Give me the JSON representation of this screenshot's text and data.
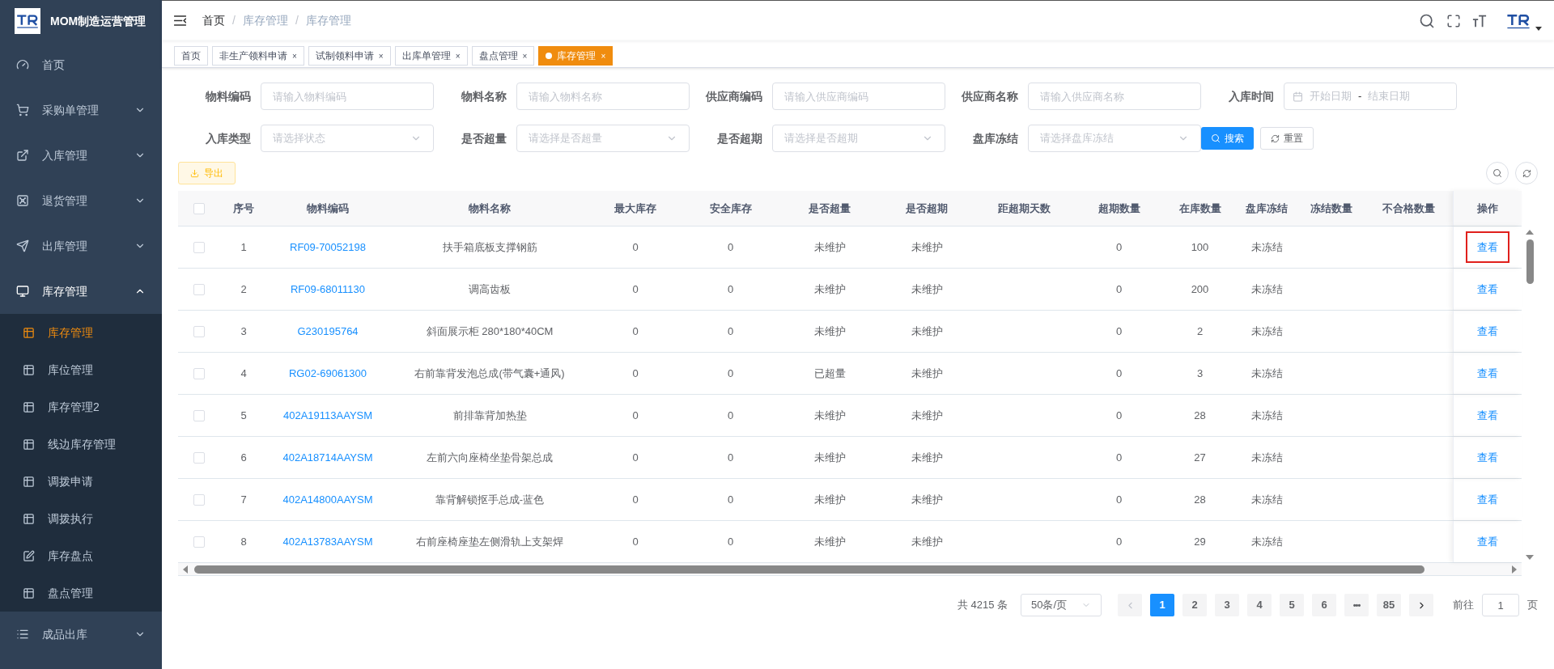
{
  "sidebar": {
    "title": "MOM制造运营管理",
    "items": [
      {
        "label": "首页",
        "kind": "link"
      },
      {
        "label": "采购单管理",
        "kind": "submenu",
        "expanded": false
      },
      {
        "label": "入库管理",
        "kind": "submenu",
        "expanded": false
      },
      {
        "label": "退货管理",
        "kind": "submenu",
        "expanded": false
      },
      {
        "label": "出库管理",
        "kind": "submenu",
        "expanded": false
      },
      {
        "label": "库存管理",
        "kind": "submenu",
        "expanded": true,
        "children": [
          {
            "label": "库存管理",
            "selected": true
          },
          {
            "label": "库位管理",
            "selected": false
          },
          {
            "label": "库存管理2",
            "selected": false
          },
          {
            "label": "线边库存管理",
            "selected": false
          },
          {
            "label": "调拨申请",
            "selected": false
          },
          {
            "label": "调拨执行",
            "selected": false
          },
          {
            "label": "库存盘点",
            "selected": false
          },
          {
            "label": "盘点管理",
            "selected": false
          }
        ]
      },
      {
        "label": "成品出库",
        "kind": "submenu",
        "expanded": false
      }
    ]
  },
  "breadcrumb": {
    "separator": "/",
    "items": [
      "首页",
      "库存管理",
      "库存管理"
    ]
  },
  "tabs": [
    {
      "label": "首页",
      "selected": false
    },
    {
      "label": "非生产领料申请",
      "selected": false,
      "close": "×"
    },
    {
      "label": "试制领料申请",
      "selected": false,
      "close": "×"
    },
    {
      "label": "出库单管理",
      "selected": false,
      "close": "×"
    },
    {
      "label": "盘点管理",
      "selected": false,
      "close": "×"
    },
    {
      "label": "库存管理",
      "selected": true,
      "close": "×"
    }
  ],
  "filters": [
    {
      "label": "物料编码",
      "kind": "input",
      "placeholder": "请输入物料编码"
    },
    {
      "label": "物料名称",
      "kind": "input",
      "placeholder": "请输入物料名称"
    },
    {
      "label": "供应商编码",
      "kind": "input",
      "placeholder": "请输入供应商编码"
    },
    {
      "label": "供应商名称",
      "kind": "input",
      "placeholder": "请输入供应商名称"
    },
    {
      "label": "入库时间",
      "kind": "daterange",
      "placeholder": "开始日期",
      "placeholder_end": "结束日期",
      "separator": "-"
    },
    {
      "label": "入库类型",
      "kind": "select",
      "placeholder": "请选择状态"
    },
    {
      "label": "是否超量",
      "kind": "select",
      "placeholder": "请选择是否超量"
    },
    {
      "label": "是否超期",
      "kind": "select",
      "placeholder": "请选择是否超期"
    },
    {
      "label": "盘库冻结",
      "kind": "select",
      "placeholder": "请选择盘库冻结"
    }
  ],
  "search_button": "搜索",
  "reset_button": "重置",
  "export_button": "导出",
  "table": {
    "all_checked": false,
    "columns": [
      "序号",
      "物料编码",
      "物料名称",
      "最大库存",
      "安全库存",
      "是否超量",
      "是否超期",
      "距超期天数",
      "超期数量",
      "在库数量",
      "盘库冻结",
      "冻结数量",
      "不合格数量",
      "操作"
    ],
    "rows": [
      {
        "checked": false,
        "highlighted": true,
        "cells": [
          "1",
          "RF09-70052198",
          "扶手箱底板支撑钢筋",
          "0",
          "0",
          "未维护",
          "未维护",
          "",
          "0",
          "100",
          "未冻结",
          "",
          "",
          "查看"
        ]
      },
      {
        "checked": false,
        "highlighted": false,
        "cells": [
          "2",
          "RF09-68011130",
          "调高齿板",
          "0",
          "0",
          "未维护",
          "未维护",
          "",
          "0",
          "200",
          "未冻结",
          "",
          "",
          "查看"
        ]
      },
      {
        "checked": false,
        "highlighted": false,
        "cells": [
          "3",
          "G230195764",
          "斜面展示柜 280*180*40CM",
          "0",
          "0",
          "未维护",
          "未维护",
          "",
          "0",
          "2",
          "未冻结",
          "",
          "",
          "查看"
        ]
      },
      {
        "checked": false,
        "highlighted": false,
        "cells": [
          "4",
          "RG02-69061300",
          "右前靠背发泡总成(带气囊+通风)",
          "0",
          "0",
          "已超量",
          "未维护",
          "",
          "0",
          "3",
          "未冻结",
          "",
          "",
          "查看"
        ]
      },
      {
        "checked": false,
        "highlighted": false,
        "cells": [
          "5",
          "402A19113AAYSM",
          "前排靠背加热垫",
          "0",
          "0",
          "未维护",
          "未维护",
          "",
          "0",
          "28",
          "未冻结",
          "",
          "",
          "查看"
        ]
      },
      {
        "checked": false,
        "highlighted": false,
        "cells": [
          "6",
          "402A18714AAYSM",
          "左前六向座椅坐垫骨架总成",
          "0",
          "0",
          "未维护",
          "未维护",
          "",
          "0",
          "27",
          "未冻结",
          "",
          "",
          "查看"
        ]
      },
      {
        "checked": false,
        "highlighted": false,
        "cells": [
          "7",
          "402A14800AAYSM",
          "靠背解锁抠手总成-蓝色",
          "0",
          "0",
          "未维护",
          "未维护",
          "",
          "0",
          "28",
          "未冻结",
          "",
          "",
          "查看"
        ]
      },
      {
        "checked": false,
        "highlighted": false,
        "cells": [
          "8",
          "402A13783AAYSM",
          "右前座椅座垫左侧滑轨上支架焊",
          "0",
          "0",
          "未维护",
          "未维护",
          "",
          "0",
          "29",
          "未冻结",
          "",
          "",
          "查看"
        ]
      }
    ]
  },
  "pagination": {
    "total": "共 4215 条",
    "page_size": "50条/页",
    "pages": [
      {
        "label": "1",
        "kind": "page",
        "selected": true
      },
      {
        "label": "2",
        "kind": "page",
        "selected": false
      },
      {
        "label": "3",
        "kind": "page",
        "selected": false
      },
      {
        "label": "4",
        "kind": "page",
        "selected": false
      },
      {
        "label": "5",
        "kind": "page",
        "selected": false
      },
      {
        "label": "6",
        "kind": "page",
        "selected": false
      },
      {
        "label": "•••",
        "kind": "more",
        "selected": false
      },
      {
        "label": "85",
        "kind": "page",
        "selected": false
      }
    ],
    "prev_disabled": true,
    "goto_label": "前往",
    "goto_value": "1",
    "goto_suffix": "页"
  }
}
